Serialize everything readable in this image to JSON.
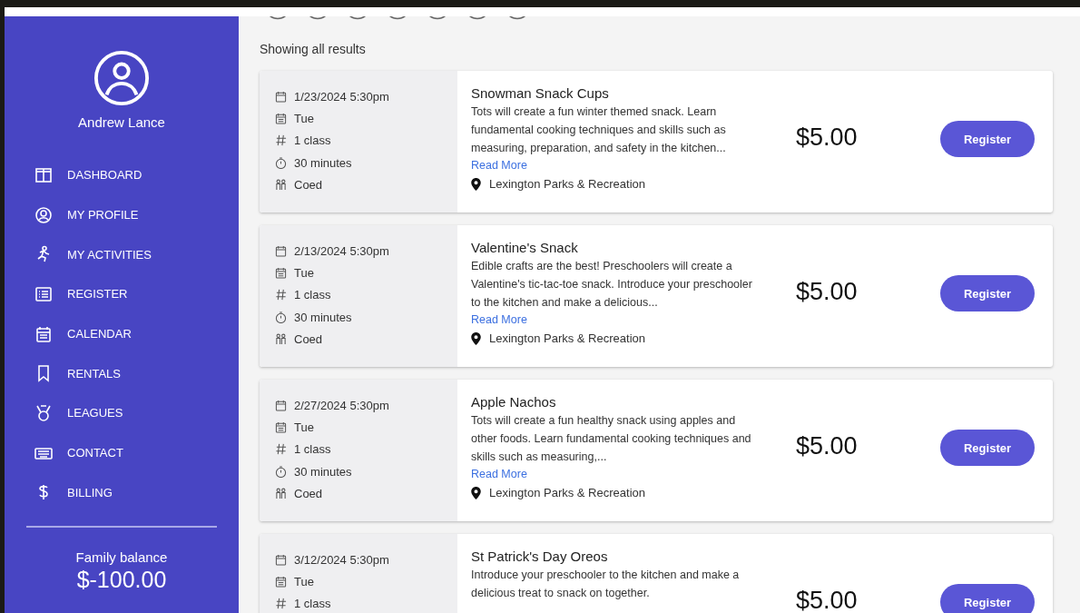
{
  "user": {
    "name": "Andrew Lance"
  },
  "nav": [
    {
      "label": "DASHBOARD",
      "kind": "dashboard"
    },
    {
      "label": "MY PROFILE",
      "kind": "profile"
    },
    {
      "label": "MY ACTIVITIES",
      "kind": "activities"
    },
    {
      "label": "REGISTER",
      "kind": "register"
    },
    {
      "label": "CALENDAR",
      "kind": "calendar"
    },
    {
      "label": "RENTALS",
      "kind": "rentals"
    },
    {
      "label": "LEAGUES",
      "kind": "leagues"
    },
    {
      "label": "CONTACT",
      "kind": "contact"
    },
    {
      "label": "BILLING",
      "kind": "billing"
    }
  ],
  "balance": {
    "label": "Family balance",
    "amount": "$-100.00"
  },
  "results_label": "Showing all results",
  "activities": [
    {
      "meta": [
        {
          "kind": "date",
          "text": "1/23/2024 5:30pm"
        },
        {
          "kind": "day",
          "text": "Tue"
        },
        {
          "kind": "count",
          "text": "1 class"
        },
        {
          "kind": "duration",
          "text": "30 minutes"
        },
        {
          "kind": "gender",
          "text": "Coed"
        }
      ],
      "title": "Snowman Snack Cups",
      "description": "Tots will create a fun winter themed snack. Learn fundamental cooking techniques and skills such as measuring, preparation, and safety in the kitchen...",
      "read_more": "Read More",
      "location": "Lexington Parks & Recreation",
      "price": "$5.00",
      "button": "Register"
    },
    {
      "meta": [
        {
          "kind": "date",
          "text": "2/13/2024 5:30pm"
        },
        {
          "kind": "day",
          "text": "Tue"
        },
        {
          "kind": "count",
          "text": "1 class"
        },
        {
          "kind": "duration",
          "text": "30 minutes"
        },
        {
          "kind": "gender",
          "text": "Coed"
        }
      ],
      "title": "Valentine's Snack",
      "description": "Edible crafts are the best! Preschoolers will create a Valentine's tic-tac-toe snack. Introduce your preschooler to the kitchen and make a delicious...",
      "read_more": "Read More",
      "location": "Lexington Parks & Recreation",
      "price": "$5.00",
      "button": "Register"
    },
    {
      "meta": [
        {
          "kind": "date",
          "text": "2/27/2024 5:30pm"
        },
        {
          "kind": "day",
          "text": "Tue"
        },
        {
          "kind": "count",
          "text": "1 class"
        },
        {
          "kind": "duration",
          "text": "30 minutes"
        },
        {
          "kind": "gender",
          "text": "Coed"
        }
      ],
      "title": "Apple Nachos",
      "description": "Tots will create a fun healthy snack using apples and other foods. Learn fundamental cooking techniques and skills such as measuring,...",
      "read_more": "Read More",
      "location": "Lexington Parks & Recreation",
      "price": "$5.00",
      "button": "Register"
    },
    {
      "meta": [
        {
          "kind": "date",
          "text": "3/12/2024 5:30pm"
        },
        {
          "kind": "day",
          "text": "Tue"
        },
        {
          "kind": "count",
          "text": "1 class"
        }
      ],
      "title": "St Patrick's Day Oreos",
      "description": "Introduce your preschooler to the kitchen and make a delicious treat to snack on together.",
      "price": "$5.00",
      "button": "Register"
    }
  ]
}
